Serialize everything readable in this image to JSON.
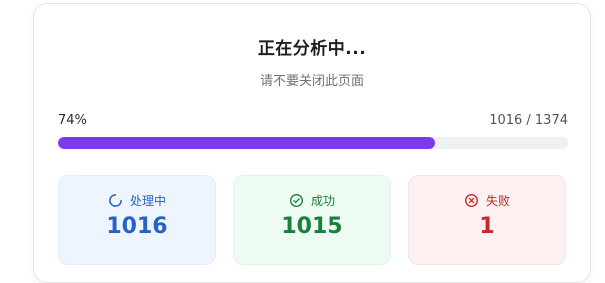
{
  "dialog": {
    "title": "正在分析中...",
    "subtitle": "请不要关闭此页面"
  },
  "progress": {
    "percent_label": "74%",
    "count_label": "1016 / 1374",
    "fraction": 0.74,
    "bar_color": "#7c3aed"
  },
  "stats": {
    "processing": {
      "label": "处理中",
      "value": "1016",
      "icon": "spinner-icon",
      "color": "#2563c9"
    },
    "success": {
      "label": "成功",
      "value": "1015",
      "icon": "check-circle-icon",
      "color": "#16803d"
    },
    "failed": {
      "label": "失败",
      "value": "1",
      "icon": "x-circle-icon",
      "color": "#c62828"
    }
  }
}
